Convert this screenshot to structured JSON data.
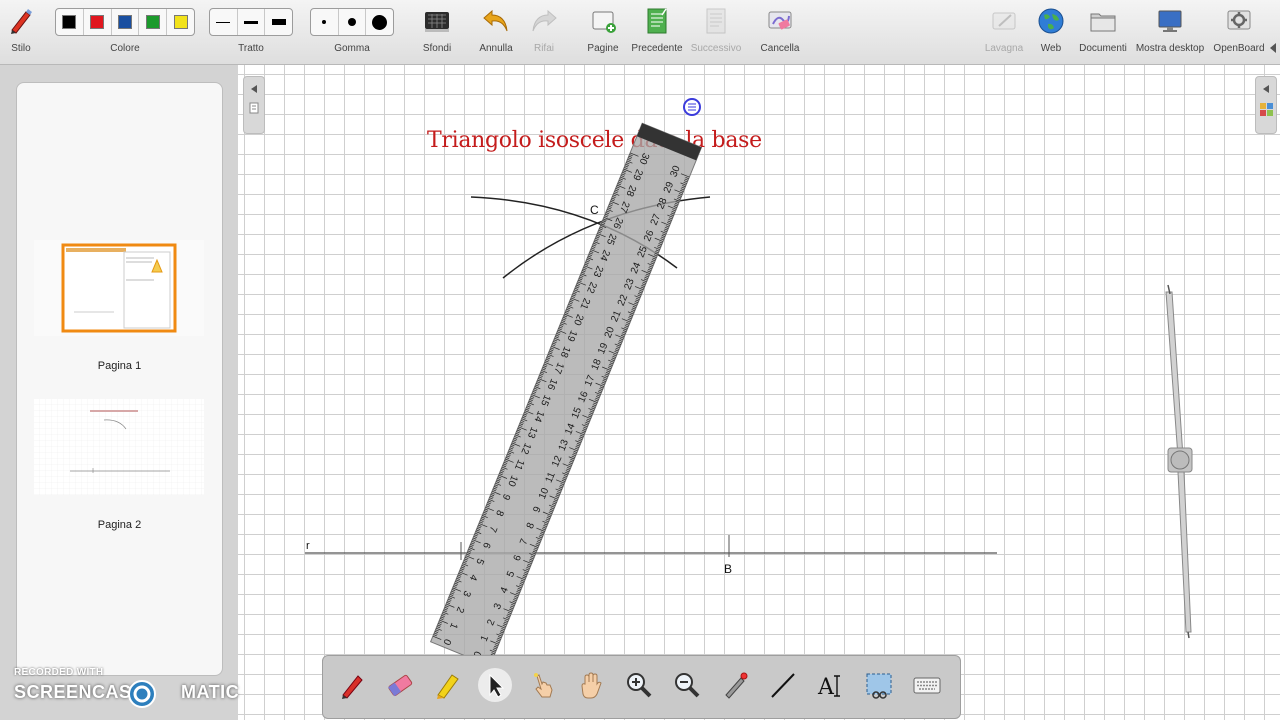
{
  "toolbar": {
    "stilo": "Stilo",
    "colore": "Colore",
    "tratto": "Tratto",
    "gomma": "Gomma",
    "sfondi": "Sfondi",
    "annulla": "Annulla",
    "rifai": "Rifai",
    "pagine": "Pagine",
    "precedente": "Precedente",
    "successivo": "Successivo",
    "cancella": "Cancella",
    "lavagna": "Lavagna",
    "web": "Web",
    "documenti": "Documenti",
    "mostra_desktop": "Mostra desktop",
    "openboard": "OpenBoard",
    "colors": [
      "#000000",
      "#e0161e",
      "#1a4fa0",
      "#1c9a2c",
      "#f2e21a"
    ],
    "disabled": [
      "rifai",
      "successivo",
      "lavagna"
    ]
  },
  "pages": [
    {
      "label": "Pagina 1"
    },
    {
      "label": "Pagina 2"
    }
  ],
  "board": {
    "title": "Triangolo isoscele data la base",
    "point_c": "C",
    "point_b": "B",
    "line_r": "r"
  },
  "ruler_numbers": [
    "0",
    "1",
    "2",
    "3",
    "4",
    "5",
    "6",
    "7",
    "8",
    "9",
    "10",
    "11",
    "12",
    "13",
    "14",
    "15",
    "16",
    "17",
    "18",
    "19",
    "20",
    "21",
    "22",
    "23",
    "24",
    "25",
    "26",
    "27",
    "28",
    "29",
    "30"
  ],
  "bottom_tools": [
    "pen-icon",
    "eraser-icon",
    "highlighter-icon",
    "pointer-icon",
    "interact-hand-icon",
    "hand-icon",
    "zoom-in-icon",
    "zoom-out-icon",
    "laser-pointer-icon",
    "line-icon",
    "text-icon",
    "capture-icon",
    "keyboard-icon"
  ],
  "watermark": {
    "line1": "RECORDED WITH",
    "line2a": "SCREENCAST",
    "line2b": "MATIC"
  }
}
